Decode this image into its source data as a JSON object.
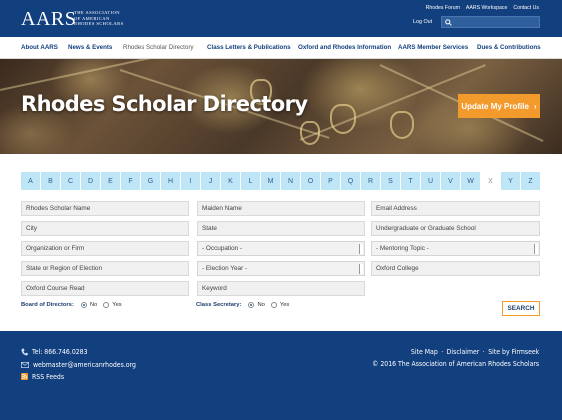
{
  "header": {
    "logo": "AARS",
    "logo_sub_1": "THE ASSOCIATION",
    "logo_sub_2": "OF AMERICAN",
    "logo_sub_3": "RHODES SCHOLARS",
    "top_links": [
      "Rhodes Forum",
      "AARS Workspace",
      "Contact Us"
    ],
    "logout": "Log Out"
  },
  "nav": {
    "items": [
      "About AARS",
      "News & Events",
      "Rhodes Scholar Directory",
      "Class Letters & Publications",
      "Oxford and Rhodes Information",
      "AARS Member Services",
      "Dues & Contributions"
    ],
    "active_index": 2
  },
  "hero": {
    "title": "Rhodes Scholar Directory",
    "update_button": "Update My Profile",
    "update_arrow": "›"
  },
  "alphabet": {
    "letters": [
      "A",
      "B",
      "C",
      "D",
      "E",
      "F",
      "G",
      "H",
      "I",
      "J",
      "K",
      "L",
      "M",
      "N",
      "O",
      "P",
      "Q",
      "R",
      "S",
      "T",
      "U",
      "V",
      "W",
      "X",
      "Y",
      "Z"
    ],
    "disabled": [
      "X"
    ]
  },
  "form": {
    "rhodes_scholar_name": "Rhodes Scholar Name",
    "maiden_name": "Maiden Name",
    "email": "Email Address",
    "city": "City",
    "state": "State",
    "school": "Undergraduate or Graduate School",
    "organization": "Organization or Firm",
    "occupation": "- Occupation -",
    "mentoring": "- Mentoring Topic -",
    "region": "State or Region of Election",
    "election_year": "- Election Year -",
    "oxford_college": "Oxford College",
    "oxford_course": "Oxford Course Read",
    "keyword": "Keyword",
    "board_label": "Board of Directors:",
    "secretary_label": "Class Secretary:",
    "no_label": "No",
    "yes_label": "Yes",
    "board_value": "No",
    "secretary_value": "No",
    "search_button": "SEARCH"
  },
  "footer": {
    "phone": "Tel: 866.746.0283",
    "email": "webmaster@americanrhodes.org",
    "rss": "RSS Feeds",
    "links": [
      "Site Map",
      "Disclaimer",
      "Site by Firmseek"
    ],
    "copyright": "© 2016 The Association of American Rhodes Scholars"
  },
  "colors": {
    "navy": "#123f7e",
    "accent_orange": "#f39a2c",
    "alpha_bg": "#bfe6f7"
  }
}
